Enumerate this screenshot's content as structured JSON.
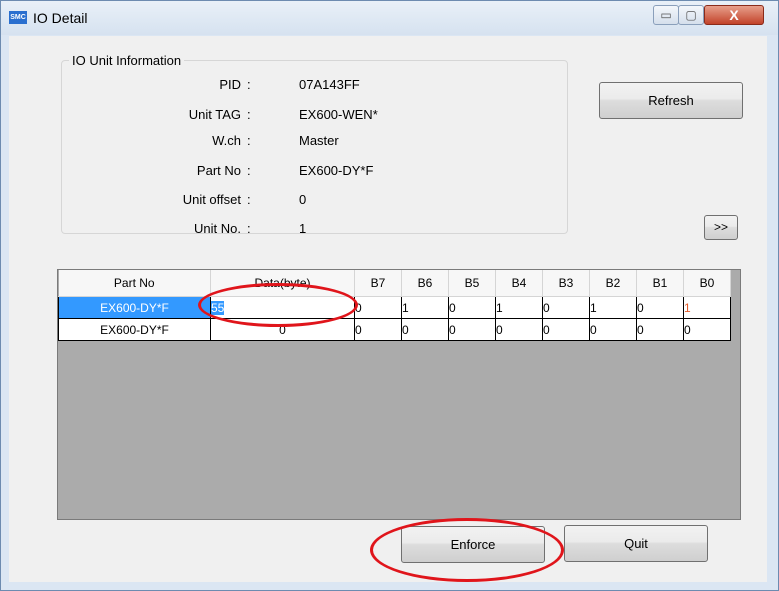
{
  "window": {
    "title": "IO Detail",
    "icon": "SMC",
    "controls": {
      "minimize": "▭",
      "maximize": "▢",
      "close": "X"
    }
  },
  "info_group": {
    "title": "IO Unit Information",
    "rows": [
      {
        "label": "PID",
        "colon": ":",
        "value": "07A143FF"
      },
      {
        "label": "Unit TAG",
        "colon": ":",
        "value": "EX600-WEN*"
      },
      {
        "label": "W.ch",
        "colon": ":",
        "value": "Master"
      },
      {
        "label": "Part No",
        "colon": ":",
        "value": "EX600-DY*F"
      },
      {
        "label": "Unit offset",
        "colon": ":",
        "value": "0"
      },
      {
        "label": "Unit No.",
        "colon": ":",
        "value": "1"
      }
    ]
  },
  "buttons": {
    "refresh": "Refresh",
    "more": ">>",
    "enforce": "Enforce",
    "quit": "Quit"
  },
  "table": {
    "headers": [
      "Part No",
      "Data(byte)",
      "B7",
      "B6",
      "B5",
      "B4",
      "B3",
      "B2",
      "B1",
      "B0"
    ],
    "rows": [
      {
        "part_no": "EX600-DY*F",
        "data": "55",
        "bits": [
          "0",
          "1",
          "0",
          "1",
          "0",
          "1",
          "0",
          "1"
        ],
        "selected": true
      },
      {
        "part_no": "EX600-DY*F",
        "data": "0",
        "bits": [
          "0",
          "0",
          "0",
          "0",
          "0",
          "0",
          "0",
          "0"
        ],
        "selected": false
      }
    ]
  },
  "colors": {
    "selection": "#3399ff",
    "annotation": "#e0151b",
    "changed_bit": "#e35a2a"
  }
}
